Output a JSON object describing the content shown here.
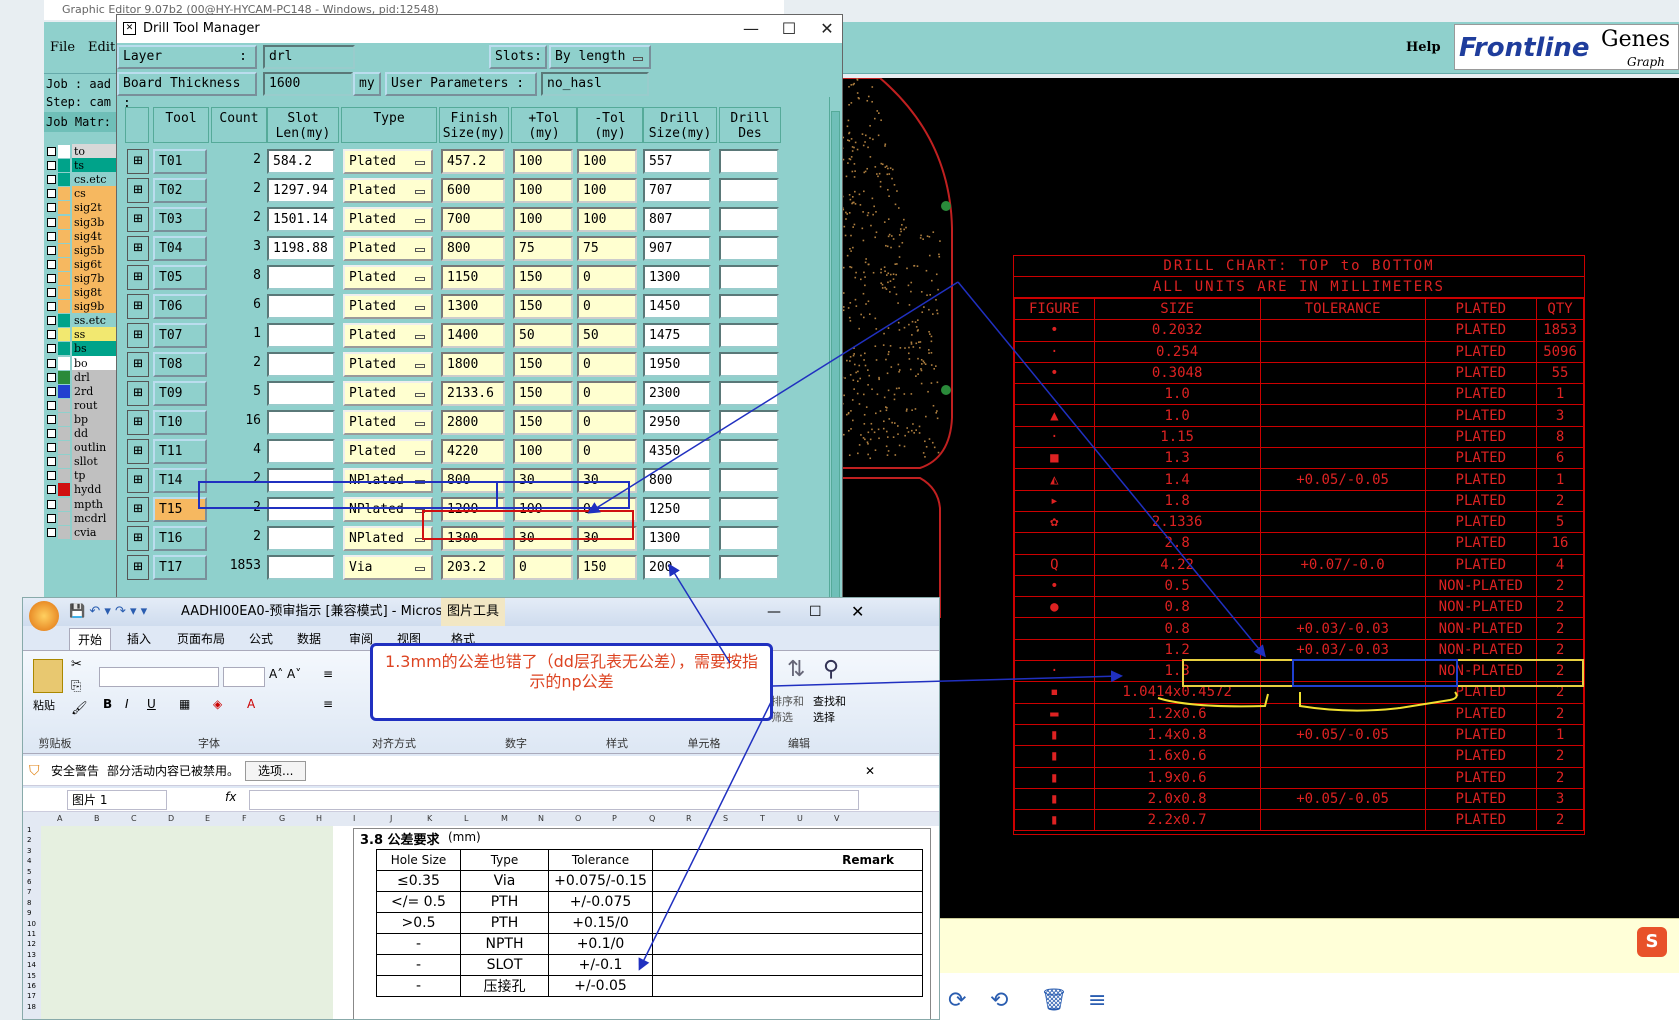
{
  "genesis": {
    "title": "Graphic Editor 9.07b2 (00@HY-HYCAM-PC148 - Windows, pid:12548)",
    "menu_file": "File",
    "menu_edit": "Edit",
    "help": "Help",
    "brand": "Frontline",
    "brand2": "Genes",
    "brand3": "Graph",
    "job": "Job : aad",
    "step": "Step: cam",
    "matrix": "Job Matr:",
    "layers": [
      {
        "name": "to",
        "color": "#d8d8d8",
        "sw": "#ffffff"
      },
      {
        "name": "ts",
        "color": "#00a38a",
        "sw": "#00a38a"
      },
      {
        "name": "cs.etc",
        "color": "#8fd0cc",
        "sw": "#00a38a"
      },
      {
        "name": "cs",
        "color": "#f6b860",
        "sw": "#f6b860"
      },
      {
        "name": "sig2t",
        "color": "#f6b860",
        "sw": "#f6b860"
      },
      {
        "name": "sig3b",
        "color": "#f6b860",
        "sw": "#f6b860"
      },
      {
        "name": "sig4t",
        "color": "#f6b860",
        "sw": "#f6b860"
      },
      {
        "name": "sig5b",
        "color": "#f6b860",
        "sw": "#f6b860"
      },
      {
        "name": "sig6t",
        "color": "#f6b860",
        "sw": "#f6b860"
      },
      {
        "name": "sig7b",
        "color": "#f6b860",
        "sw": "#f6b860"
      },
      {
        "name": "sig8t",
        "color": "#f6b860",
        "sw": "#f6b860"
      },
      {
        "name": "sig9b",
        "color": "#f6b860",
        "sw": "#f6b860"
      },
      {
        "name": "ss.etc",
        "color": "#8fd0cc",
        "sw": "#00a38a"
      },
      {
        "name": "ss",
        "color": "#f2e870",
        "sw": "#f2e870"
      },
      {
        "name": "bs",
        "color": "#00a38a",
        "sw": "#00a38a"
      },
      {
        "name": "bo",
        "color": "#ffffff",
        "sw": "#ffffff"
      },
      {
        "name": "drl",
        "color": "#c0c0c0",
        "sw": "#2a8a3a"
      },
      {
        "name": "2rd",
        "color": "#c0c0c0",
        "sw": "#2040d0"
      },
      {
        "name": "rout",
        "color": "#c0c0c0",
        "sw": "#c0c0c0"
      },
      {
        "name": "bp",
        "color": "#c0c0c0",
        "sw": "#c0c0c0"
      },
      {
        "name": "dd",
        "color": "#c0c0c0",
        "sw": "#c0c0c0"
      },
      {
        "name": "outlin",
        "color": "#c0c0c0",
        "sw": "#c0c0c0"
      },
      {
        "name": "sllot",
        "color": "#c0c0c0",
        "sw": "#c0c0c0"
      },
      {
        "name": "tp",
        "color": "#c0c0c0",
        "sw": "#c0c0c0"
      },
      {
        "name": "hydd",
        "color": "#c0c0c0",
        "sw": "#d01010"
      },
      {
        "name": "mpth",
        "color": "#c0c0c0",
        "sw": "#c0c0c0"
      },
      {
        "name": "mcdrl",
        "color": "#c0c0c0",
        "sw": "#c0c0c0"
      },
      {
        "name": "cvia",
        "color": "#c0c0c0",
        "sw": "#c0c0c0"
      }
    ]
  },
  "drill_chart": {
    "title": "DRILL CHART: TOP to BOTTOM",
    "subtitle": "ALL UNITS ARE IN MILLIMETERS",
    "headers": [
      "FIGURE",
      "SIZE",
      "TOLERANCE",
      "PLATED",
      "QTY"
    ],
    "rows": [
      [
        "•",
        "0.2032",
        "",
        "PLATED",
        "1853"
      ],
      [
        "·",
        "0.254",
        "",
        "PLATED",
        "5096"
      ],
      [
        "•",
        "0.3048",
        "",
        "PLATED",
        "55"
      ],
      [
        "",
        "1.0",
        "",
        "PLATED",
        "1"
      ],
      [
        "▲",
        "1.0",
        "",
        "PLATED",
        "3"
      ],
      [
        "·",
        "1.15",
        "",
        "PLATED",
        "8"
      ],
      [
        "■",
        "1.3",
        "",
        "PLATED",
        "6"
      ],
      [
        "◭",
        "1.4",
        "+0.05/-0.05",
        "PLATED",
        "1"
      ],
      [
        "▸",
        "1.8",
        "",
        "PLATED",
        "2"
      ],
      [
        "✿",
        "2.1336",
        "",
        "PLATED",
        "5"
      ],
      [
        "",
        "2.8",
        "",
        "PLATED",
        "16"
      ],
      [
        "Q",
        "4.22",
        "+0.07/-0.0",
        "PLATED",
        "4"
      ],
      [
        "•",
        "0.5",
        "",
        "NON-PLATED",
        "2"
      ],
      [
        "●",
        "0.8",
        "",
        "NON-PLATED",
        "2"
      ],
      [
        "",
        "0.8",
        "+0.03/-0.03",
        "NON-PLATED",
        "2"
      ],
      [
        "",
        "1.2",
        "+0.03/-0.03",
        "NON-PLATED",
        "2"
      ],
      [
        "·",
        "1.3",
        "",
        "NON-PLATED",
        "2"
      ],
      [
        "▪",
        "1.0414x0.4572",
        "",
        "PLATED",
        "2"
      ],
      [
        "▬",
        "1.2x0.6",
        "",
        "PLATED",
        "2"
      ],
      [
        "▮",
        "1.4x0.8",
        "+0.05/-0.05",
        "PLATED",
        "1"
      ],
      [
        "▮",
        "1.6x0.6",
        "",
        "PLATED",
        "2"
      ],
      [
        "▮",
        "1.9x0.6",
        "",
        "PLATED",
        "2"
      ],
      [
        "▮",
        "2.0x0.8",
        "+0.05/-0.05",
        "PLATED",
        "3"
      ],
      [
        "▮",
        "2.2x0.7",
        "",
        "PLATED",
        "2"
      ]
    ]
  },
  "dtm": {
    "title": "Drill Tool Manager",
    "layer_label": "Layer",
    "layer_value": "drl",
    "slots_label": "Slots:",
    "slots_value": "By length",
    "thickness_label": "Board Thickness :",
    "thickness_value": "1600",
    "thickness_unit": "my",
    "user_params_label": "User Parameters :",
    "user_params_value": "no_hasl",
    "columns": [
      "Tool",
      "Count",
      "Slot Len(my)",
      "Type",
      "Finish Size(my)",
      "+Tol (my)",
      "-Tol (my)",
      "Drill Size(my)",
      "Drill Des"
    ],
    "rows": [
      {
        "tool": "T01",
        "count": "2",
        "slot": "584.2",
        "type": "Plated",
        "finish": "457.2",
        "ptol": "100",
        "ntol": "100",
        "drill": "557"
      },
      {
        "tool": "T02",
        "count": "2",
        "slot": "1297.94",
        "type": "Plated",
        "finish": "600",
        "ptol": "100",
        "ntol": "100",
        "drill": "707"
      },
      {
        "tool": "T03",
        "count": "2",
        "slot": "1501.14",
        "type": "Plated",
        "finish": "700",
        "ptol": "100",
        "ntol": "100",
        "drill": "807"
      },
      {
        "tool": "T04",
        "count": "3",
        "slot": "1198.88",
        "type": "Plated",
        "finish": "800",
        "ptol": "75",
        "ntol": "75",
        "drill": "907"
      },
      {
        "tool": "T05",
        "count": "8",
        "slot": "",
        "type": "Plated",
        "finish": "1150",
        "ptol": "150",
        "ntol": "0",
        "drill": "1300"
      },
      {
        "tool": "T06",
        "count": "6",
        "slot": "",
        "type": "Plated",
        "finish": "1300",
        "ptol": "150",
        "ntol": "0",
        "drill": "1450"
      },
      {
        "tool": "T07",
        "count": "1",
        "slot": "",
        "type": "Plated",
        "finish": "1400",
        "ptol": "50",
        "ntol": "50",
        "drill": "1475"
      },
      {
        "tool": "T08",
        "count": "2",
        "slot": "",
        "type": "Plated",
        "finish": "1800",
        "ptol": "150",
        "ntol": "0",
        "drill": "1950"
      },
      {
        "tool": "T09",
        "count": "5",
        "slot": "",
        "type": "Plated",
        "finish": "2133.6",
        "ptol": "150",
        "ntol": "0",
        "drill": "2300"
      },
      {
        "tool": "T10",
        "count": "16",
        "slot": "",
        "type": "Plated",
        "finish": "2800",
        "ptol": "150",
        "ntol": "0",
        "drill": "2950"
      },
      {
        "tool": "T11",
        "count": "4",
        "slot": "",
        "type": "Plated",
        "finish": "4220",
        "ptol": "100",
        "ntol": "0",
        "drill": "4350"
      },
      {
        "tool": "T14",
        "count": "2",
        "slot": "",
        "type": "NPlated",
        "finish": "800",
        "ptol": "30",
        "ntol": "30",
        "drill": "800"
      },
      {
        "tool": "T15",
        "count": "2",
        "slot": "",
        "type": "NPlated",
        "finish": "1200",
        "ptol": "100",
        "ntol": "0",
        "drill": "1250"
      },
      {
        "tool": "T16",
        "count": "2",
        "slot": "",
        "type": "NPlated",
        "finish": "1300",
        "ptol": "30",
        "ntol": "30",
        "drill": "1300"
      },
      {
        "tool": "T17",
        "count": "1853",
        "slot": "",
        "type": "Via",
        "finish": "203.2",
        "ptol": "0",
        "ntol": "150",
        "drill": "200"
      }
    ]
  },
  "excel": {
    "title": "AADHI00EA0-预审指示 [兼容模式] - Micros...",
    "tools_tab": "图片工具",
    "tabs": [
      "开始",
      "插入",
      "页面布局",
      "公式",
      "数据",
      "审阅",
      "视图",
      "格式"
    ],
    "groups": [
      "剪贴板",
      "字体",
      "对齐方式",
      "数字",
      "样式",
      "单元格",
      "编辑"
    ],
    "paste": "粘贴",
    "sort_filter": "排序和筛选",
    "find_select": "查找和选择",
    "warn_title": "安全警告",
    "warn_text": "部分活动内容已被禁用。",
    "warn_button": "选项...",
    "name_box": "图片 1",
    "fx": "fx",
    "col_letters": [
      "A",
      "B",
      "C",
      "D",
      "E",
      "F",
      "G",
      "H",
      "I",
      "J",
      "K",
      "L",
      "M",
      "N",
      "O",
      "P",
      "Q",
      "R",
      "S",
      "T",
      "U",
      "V"
    ],
    "section_title": "3.8 公差要求",
    "section_unit": "(mm)",
    "tol_headers": [
      "Hole Size",
      "Type",
      "Tolerance",
      "Remark"
    ],
    "tol_rows": [
      [
        "≤0.35",
        "Via",
        "+0.075/-0.15",
        ""
      ],
      [
        "</= 0.5",
        "PTH",
        "+/-0.075",
        ""
      ],
      [
        ">0.5",
        "PTH",
        "+0.15/0",
        ""
      ],
      [
        "-",
        "NPTH",
        "+0.1/0",
        ""
      ],
      [
        "-",
        "SLOT",
        "+/-0.1",
        ""
      ],
      [
        "-",
        "压接孔",
        "+/-0.05",
        ""
      ]
    ]
  },
  "callout": {
    "text": "1.3mm的公差也错了（dd层孔表无公差），需要按指示的np公差"
  }
}
